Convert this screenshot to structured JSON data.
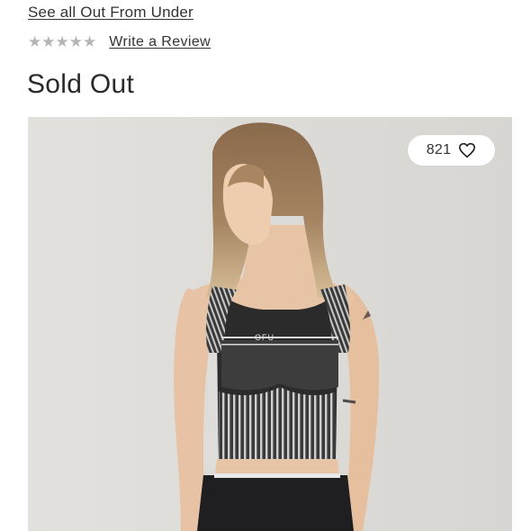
{
  "product": {
    "brand_link": "See all Out From Under",
    "review_link": "Write a Review",
    "star_count": 5,
    "status": "Sold Out"
  },
  "image": {
    "description_icon": "product-photo",
    "chest_logo": "OFU"
  },
  "like": {
    "count": "821",
    "icon": "heart-outline-icon"
  }
}
